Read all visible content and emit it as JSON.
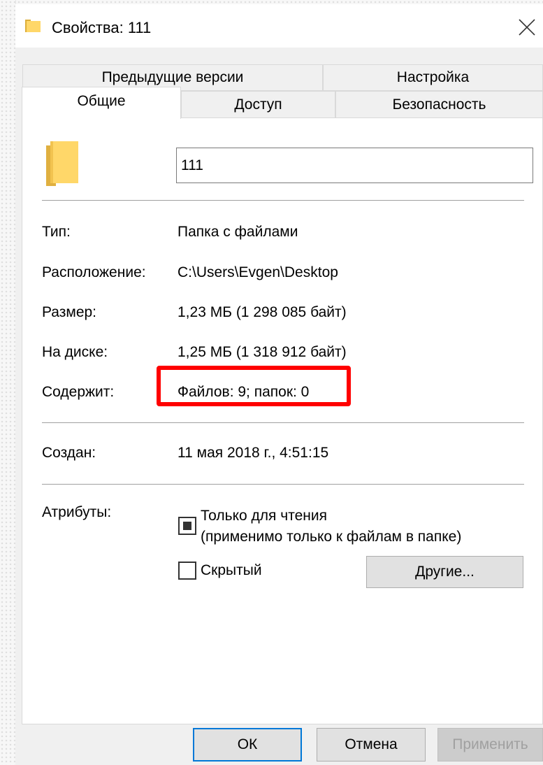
{
  "window": {
    "title": "Свойства: 111"
  },
  "tabs": {
    "previous_versions": "Предыдущие версии",
    "customize": "Настройка",
    "general": "Общие",
    "sharing": "Доступ",
    "security": "Безопасность",
    "active": "Общие"
  },
  "general": {
    "folder_name": "111",
    "type_label": "Тип:",
    "type_value": "Папка с файлами",
    "location_label": "Расположение:",
    "location_value": "C:\\Users\\Evgen\\Desktop",
    "size_label": "Размер:",
    "size_value": "1,23 МБ (1 298 085 байт)",
    "size_on_disk_label": "На диске:",
    "size_on_disk_value": "1,25 МБ (1 318 912 байт)",
    "contains_label": "Содержит:",
    "contains_value": "Файлов: 9; папок: 0",
    "created_label": "Создан:",
    "created_value": "11 мая 2018 г., 4:51:15",
    "attributes_label": "Атрибуты:",
    "readonly_line1": "Только для чтения",
    "readonly_line2": "(применимо только к файлам в папке)",
    "readonly_state": "indeterminate",
    "hidden_label": "Скрытый",
    "hidden_checked": false,
    "advanced_button": "Другие..."
  },
  "buttons": {
    "ok": "ОК",
    "cancel": "Отмена",
    "apply": "Применить"
  },
  "colors": {
    "highlight": "#ff0000",
    "default_button_border": "#0078d7",
    "folder_yellow": "#ffd769"
  }
}
